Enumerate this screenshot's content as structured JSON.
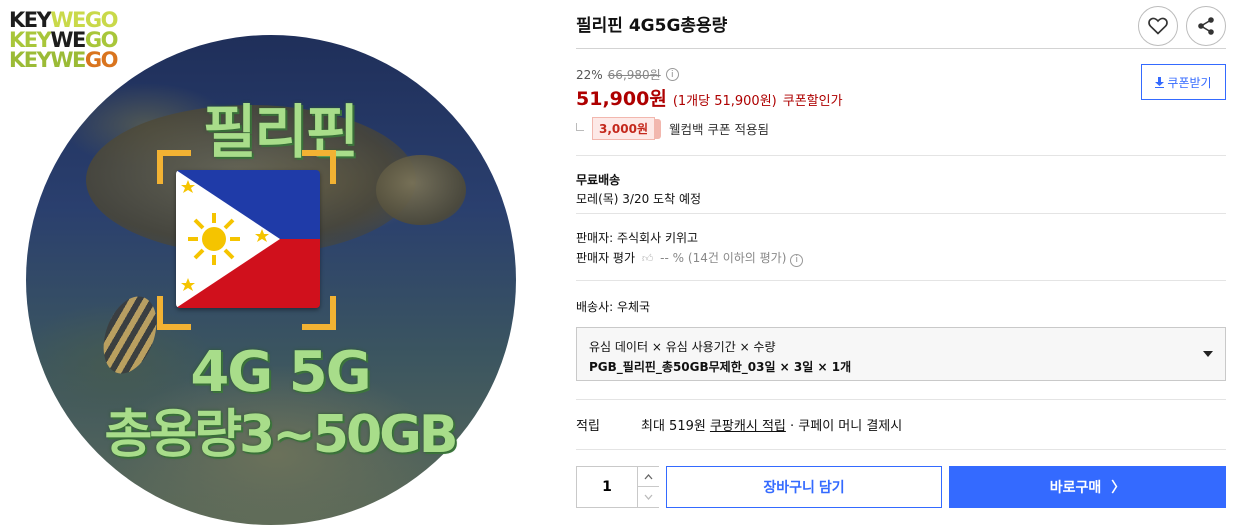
{
  "image": {
    "logo_rows": [
      {
        "a": "KEY",
        "b": "WEGO"
      },
      {
        "a": "KEY",
        "b": "WE",
        "c": "GO"
      },
      {
        "a": "KEYWE",
        "b": "GO"
      }
    ],
    "title_line1": "필리핀",
    "title_line2": "4G 5G",
    "title_line3": "총용량3~50GB"
  },
  "product": {
    "title": "필리핀 4G5G총용량",
    "discount_rate": "22%",
    "original_price": "66,980원",
    "price": "51,900원",
    "unit_price": "(1개당 51,900원)",
    "coupon_price_label": "쿠폰할인가",
    "coupon_button_label": "쿠폰받기",
    "welcome_coupon_amount": "3,000원",
    "welcome_coupon_text": "웰컴백 쿠폰 적용됨"
  },
  "shipping": {
    "label": "무료배송",
    "arrival": "모레(목) 3/20 도착 예정"
  },
  "seller": {
    "name": "판매자: 주식회사 키위고",
    "rating_label": "판매자 평가",
    "rating_value": "-- %",
    "rating_note": "(14건 이하의 평가)"
  },
  "delivery_company": "배송사: 우체국",
  "option": {
    "label": "유심 데이터 × 유심 사용기간 × 수량",
    "value": "PGB_필리핀_총50GB무제한_03일 × 3일 × 1개"
  },
  "points": {
    "label": "적립",
    "prefix": "최대 519원 ",
    "link": "쿠팡캐시 적립",
    "suffix": " · 쿠페이 머니 결제시"
  },
  "purchase": {
    "quantity": "1",
    "cart_label": "장바구니 담기",
    "buy_label": "바로구매",
    "buy_arrow": "〉"
  },
  "colors": {
    "accent_blue": "#346aff",
    "price_red": "#ae0000"
  },
  "icons": [
    "heart-icon",
    "share-icon",
    "info-icon",
    "download-icon",
    "thumbs-up-icon",
    "chevron-up-icon",
    "chevron-down-icon",
    "caret-down-icon"
  ]
}
